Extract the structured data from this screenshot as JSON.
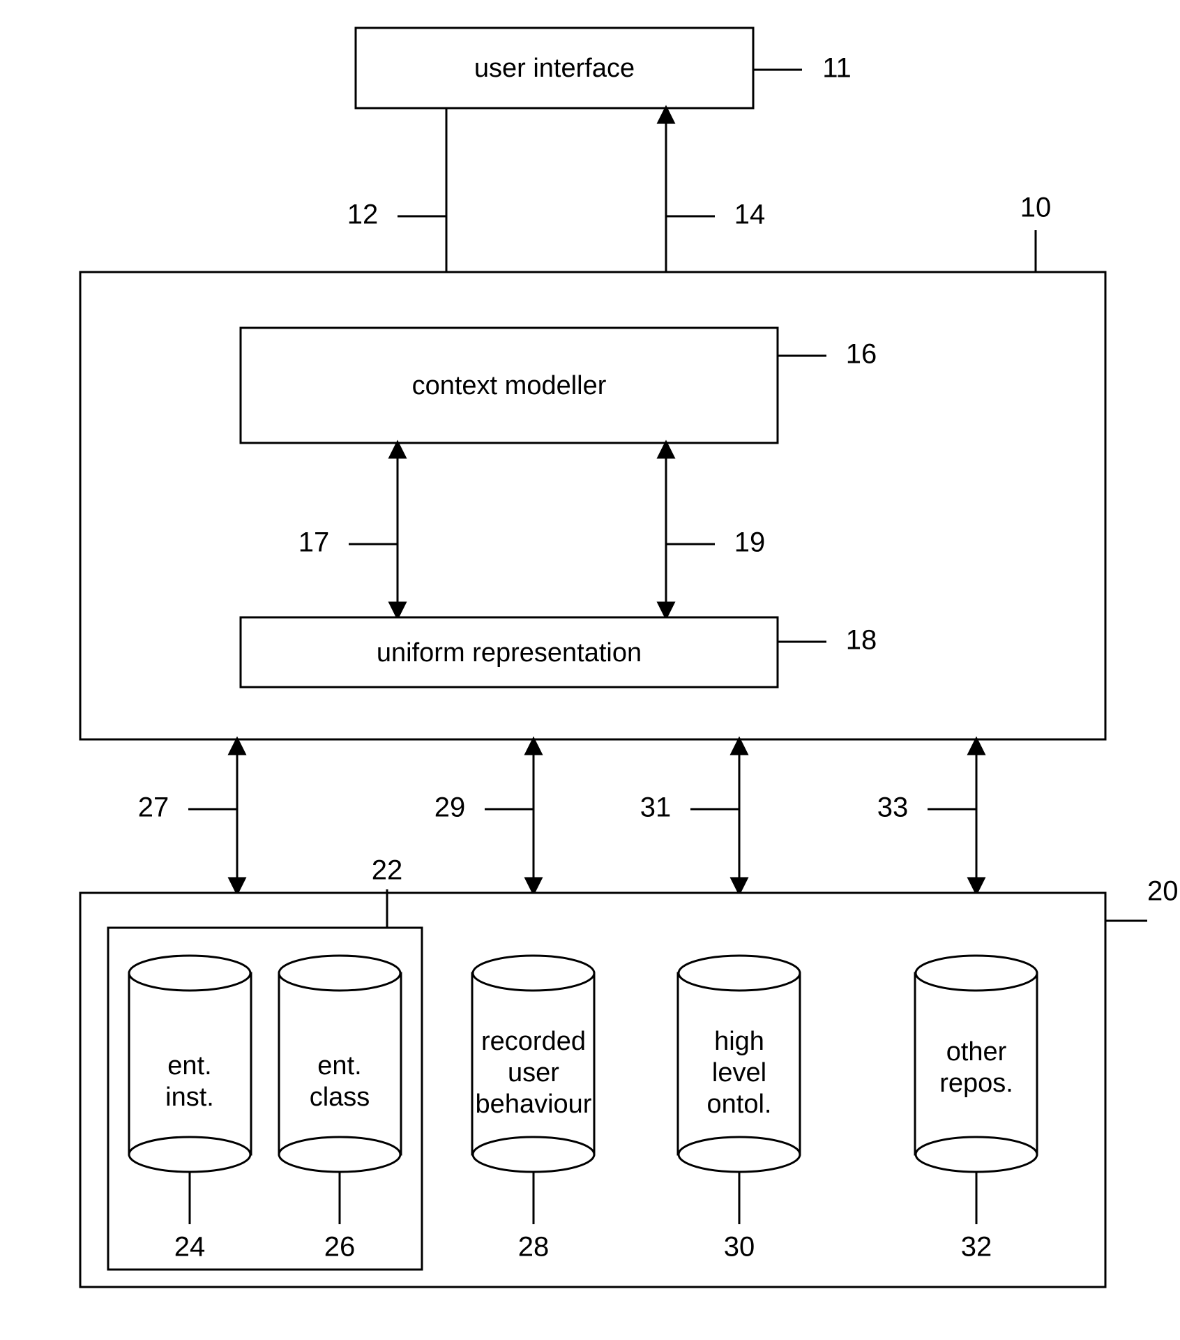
{
  "boxes": {
    "userInterface": "user interface",
    "contextModeller": "context modeller",
    "uniformRepresentation": "uniform representation"
  },
  "cylinders": {
    "entInst": [
      "ent.",
      "inst."
    ],
    "entClass": [
      "ent.",
      "class"
    ],
    "recordedUser": [
      "recorded",
      "user",
      "behaviour"
    ],
    "highLevel": [
      "high",
      "level",
      "ontol."
    ],
    "otherRepos": [
      "other",
      "repos."
    ]
  },
  "numbers": {
    "n10": "10",
    "n11": "11",
    "n12": "12",
    "n14": "14",
    "n16": "16",
    "n17": "17",
    "n18": "18",
    "n19": "19",
    "n20": "20",
    "n22": "22",
    "n24": "24",
    "n26": "26",
    "n27": "27",
    "n28": "28",
    "n29": "29",
    "n30": "30",
    "n31": "31",
    "n32": "32",
    "n33": "33"
  }
}
